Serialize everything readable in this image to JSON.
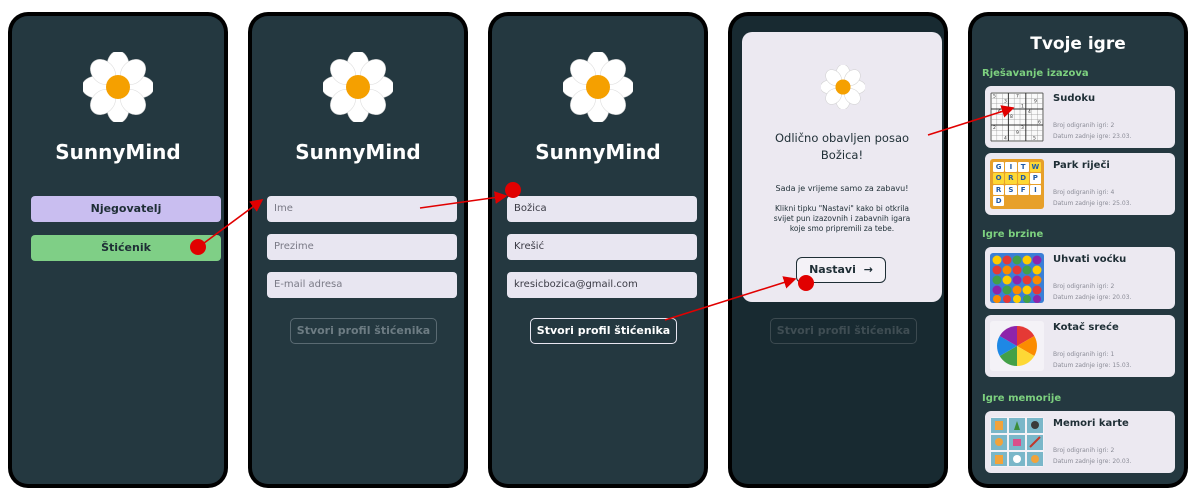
{
  "brand": {
    "name": "SunnyMind"
  },
  "screen1": {
    "caregiver_label": "Njegovatelj",
    "ward_label": "Štićenik"
  },
  "screen2": {
    "first_name_placeholder": "Ime",
    "last_name_placeholder": "Prezime",
    "email_placeholder": "E-mail adresa",
    "create_label": "Stvori profil štićenika"
  },
  "screen3": {
    "first_name_value": "Božica",
    "last_name_value": "Krešić",
    "email_value": "kresicbozica@gmail.com",
    "create_label": "Stvori profil štićenika"
  },
  "screen4": {
    "line1": "Odlično obavljen posao",
    "line2": "Božica!",
    "line3": "Sada je vrijeme samo za zabavu!",
    "line4a": "Klikni tipku \"Nastavi\" kako bi otkrila",
    "line4b": "svijet pun izazovnih i zabavnih igara",
    "line4c": "koje smo pripremili za tebe.",
    "continue_label": "Nastavi",
    "continue_arrow": "→",
    "bg_create_label": "Stvori profil štićenika"
  },
  "screen5": {
    "title": "Tvoje igre",
    "sections": {
      "challenges": "Rješavanje izazova",
      "speed": "Igre brzine",
      "memory": "Igre memorije"
    },
    "games": {
      "sudoku": {
        "name": "Sudoku",
        "plays": "Broj odigranih igri: 2",
        "last": "Datum zadnje igre: 23.03."
      },
      "words": {
        "name": "Park riječi",
        "plays": "Broj odigranih igri: 4",
        "last": "Datum zadnje igre: 25.03."
      },
      "fruit": {
        "name": "Uhvati voćku",
        "plays": "Broj odigranih igri: 2",
        "last": "Datum zadnje igre: 20.03."
      },
      "wheel": {
        "name": "Kotač sreće",
        "plays": "Broj odigranih igri: 1",
        "last": "Datum zadnje igre: 15.03."
      },
      "memory": {
        "name": "Memori karte",
        "plays": "Broj odigranih igri: 2",
        "last": "Datum zadnje igre: 20.03."
      }
    },
    "word_tiles": [
      "G",
      "I",
      "T",
      "W",
      "O",
      "R",
      "D",
      "P",
      "R",
      "S",
      "F",
      "I",
      "D"
    ]
  },
  "colors": {
    "background": "#243840",
    "caregiver_button": "#c9bef0",
    "ward_button": "#7fcf86",
    "section_heading": "#7dd17f",
    "card": "#ece9f1",
    "petal": "#ffffff",
    "center": "#f5a000",
    "annotation_red": "#e10000"
  },
  "icons": [
    "daisy-logo-icon",
    "arrow-right-icon",
    "sudoku-thumbnail",
    "word-puzzle-thumbnail",
    "fruit-thumbnail",
    "wheel-thumbnail",
    "memory-cards-thumbnail"
  ]
}
